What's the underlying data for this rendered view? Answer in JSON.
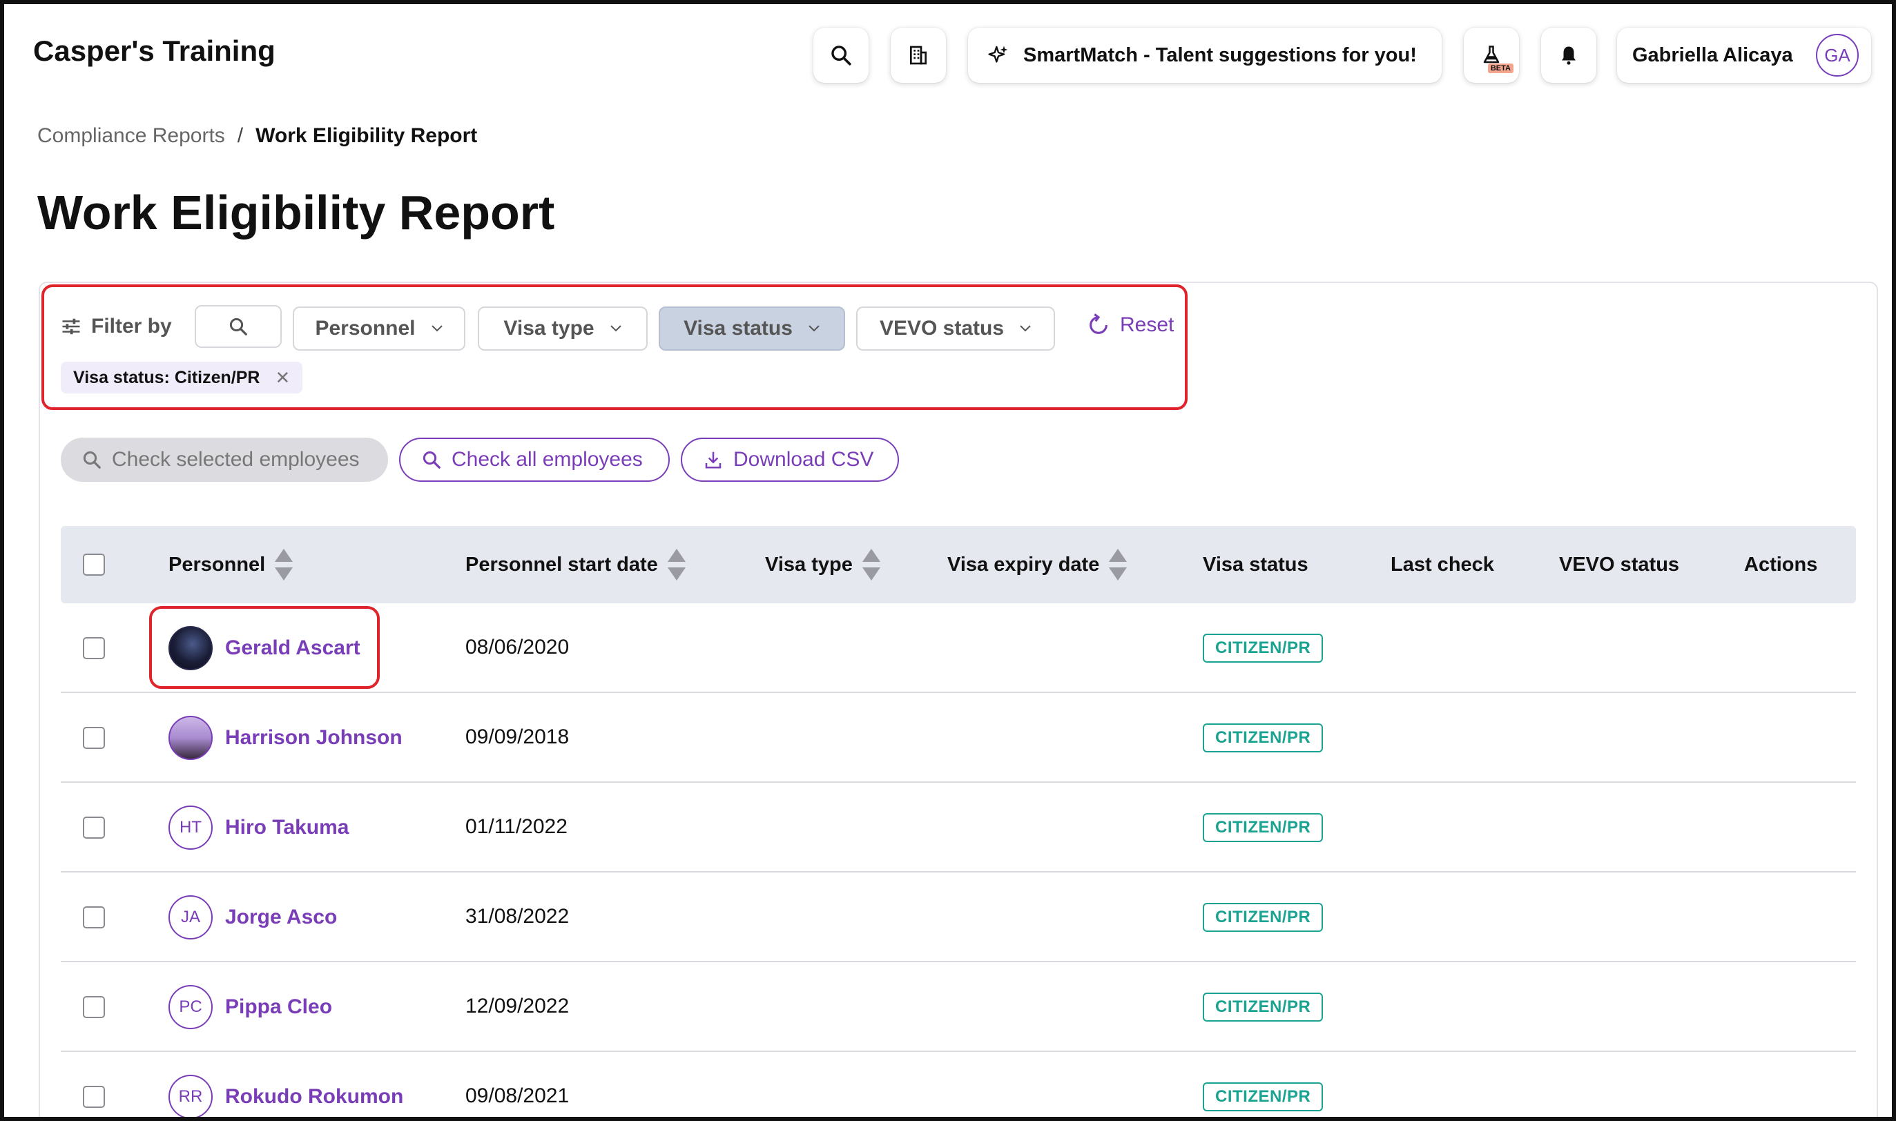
{
  "header": {
    "app_title": "Casper's Training",
    "smartmatch_label": "SmartMatch - Talent suggestions for you!",
    "beta_label": "BETA",
    "user_name": "Gabriella Alicaya",
    "user_initials": "GA"
  },
  "breadcrumb": {
    "parent": "Compliance Reports",
    "separator": "/",
    "current": "Work Eligibility Report"
  },
  "page_title": "Work Eligibility Report",
  "filters": {
    "label": "Filter by",
    "dropdowns": [
      "Personnel",
      "Visa type",
      "Visa status",
      "VEVO status"
    ],
    "active_dropdown": "Visa status",
    "reset_label": "Reset",
    "active_chip": "Visa status: Citizen/PR"
  },
  "actions": {
    "check_selected": "Check selected employees",
    "check_all": "Check all employees",
    "download_csv": "Download CSV"
  },
  "table": {
    "columns": [
      "Personnel",
      "Personnel start date",
      "Visa type",
      "Visa expiry date",
      "Visa status",
      "Last check",
      "VEVO status",
      "Actions"
    ],
    "rows": [
      {
        "name": "Gerald Ascart",
        "initials": "",
        "start_date": "08/06/2020",
        "visa_status": "CITIZEN/PR"
      },
      {
        "name": "Harrison Johnson",
        "initials": "",
        "start_date": "09/09/2018",
        "visa_status": "CITIZEN/PR"
      },
      {
        "name": "Hiro Takuma",
        "initials": "HT",
        "start_date": "01/11/2022",
        "visa_status": "CITIZEN/PR"
      },
      {
        "name": "Jorge Asco",
        "initials": "JA",
        "start_date": "31/08/2022",
        "visa_status": "CITIZEN/PR"
      },
      {
        "name": "Pippa Cleo",
        "initials": "PC",
        "start_date": "12/09/2022",
        "visa_status": "CITIZEN/PR"
      },
      {
        "name": "Rokudo Rokumon",
        "initials": "RR",
        "start_date": "09/08/2021",
        "visa_status": "CITIZEN/PR"
      }
    ]
  },
  "colors": {
    "accent": "#7a3db8",
    "status_green": "#1aa390",
    "highlight_red": "#e0242b"
  }
}
